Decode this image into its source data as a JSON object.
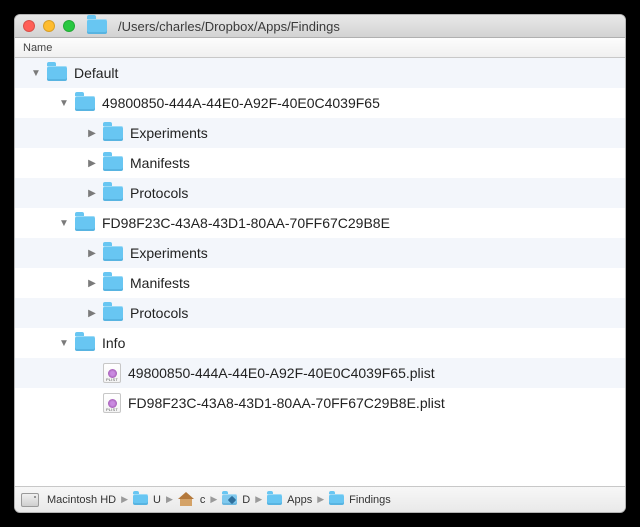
{
  "titlebar": {
    "path": "/Users/charles/Dropbox/Apps/Findings",
    "icon_tint": "#68c6f2"
  },
  "column_header": "Name",
  "tree": [
    {
      "depth": 0,
      "expanded": true,
      "icon": "folder",
      "label": "Default"
    },
    {
      "depth": 1,
      "expanded": true,
      "icon": "folder",
      "label": "49800850-444A-44E0-A92F-40E0C4039F65"
    },
    {
      "depth": 2,
      "expanded": false,
      "icon": "folder",
      "label": "Experiments"
    },
    {
      "depth": 2,
      "expanded": false,
      "icon": "folder",
      "label": "Manifests"
    },
    {
      "depth": 2,
      "expanded": false,
      "icon": "folder",
      "label": "Protocols"
    },
    {
      "depth": 1,
      "expanded": true,
      "icon": "folder",
      "label": "FD98F23C-43A8-43D1-80AA-70FF67C29B8E"
    },
    {
      "depth": 2,
      "expanded": false,
      "icon": "folder",
      "label": "Experiments"
    },
    {
      "depth": 2,
      "expanded": false,
      "icon": "folder",
      "label": "Manifests"
    },
    {
      "depth": 2,
      "expanded": false,
      "icon": "folder",
      "label": "Protocols"
    },
    {
      "depth": 1,
      "expanded": true,
      "icon": "folder",
      "label": "Info"
    },
    {
      "depth": 2,
      "expanded": null,
      "icon": "plist",
      "label": "49800850-444A-44E0-A92F-40E0C4039F65.plist"
    },
    {
      "depth": 2,
      "expanded": null,
      "icon": "plist",
      "label": "FD98F23C-43A8-43D1-80AA-70FF67C29B8E.plist"
    }
  ],
  "pathbar": [
    {
      "icon": "hd",
      "label": "Macintosh HD"
    },
    {
      "icon": "folder",
      "label": "U"
    },
    {
      "icon": "home",
      "label": "c"
    },
    {
      "icon": "dropbox",
      "label": "D"
    },
    {
      "icon": "folder",
      "label": "Apps"
    },
    {
      "icon": "folder",
      "label": "Findings"
    }
  ]
}
